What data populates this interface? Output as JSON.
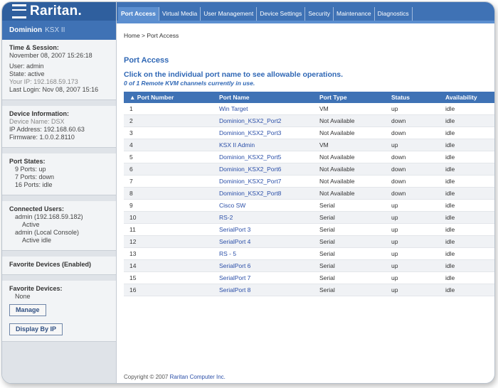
{
  "app": {
    "logo": "Raritan.",
    "product": "Dominion",
    "model": "KSX II"
  },
  "sidebar": {
    "time_session": {
      "header": "Time & Session:",
      "datetime": "November 08, 2007 15:26:18",
      "user_label": "User: admin",
      "state": "State: active",
      "ip_line": "Your IP: 192.168.59.173",
      "last_login": "Last Login: Nov 08, 2007 15:16"
    },
    "device_info": {
      "header": "Device Information:",
      "name": "Device Name: DSX",
      "ip": "IP Address: 192.168.60.63",
      "firmware": "Firmware: 1.0.0.2.8110"
    },
    "port_states": {
      "header": "Port States:",
      "up": "9 Ports: up",
      "down": "7 Ports: down",
      "idle": "16 Ports: idle"
    },
    "connected_users": {
      "header": "Connected Users:",
      "user1": "admin (192.168.59.182)",
      "user1_status": "Active",
      "user2": "admin (Local Console)",
      "user2_status": "Active idle"
    },
    "favorites_heading": "Favorite Devices (Enabled)",
    "favorite_devices": {
      "header": "Favorite Devices:",
      "value": "None",
      "manage_button": "Manage"
    },
    "display_button": "Display By IP"
  },
  "tabs": [
    "Port Access",
    "Virtual Media",
    "User Management",
    "Device Settings",
    "Security",
    "Maintenance",
    "Diagnostics"
  ],
  "active_tab": "Port Access",
  "breadcrumb": "Home > Port Access",
  "page": {
    "title": "Port Access",
    "instruction": "Click on the individual port name to see allowable operations.",
    "remote_count": "0 of 1 Remote KVM channels currently in use."
  },
  "table": {
    "headers": [
      "▲ Port Number",
      "Port Name",
      "Port Type",
      "Status",
      "Availability"
    ],
    "rows": [
      [
        "1",
        "Win Target",
        "VM",
        "up",
        "idle"
      ],
      [
        "2",
        "Dominion_KSX2_Port2",
        "Not Available",
        "down",
        "idle"
      ],
      [
        "3",
        "Dominion_KSX2_Port3",
        "Not Available",
        "down",
        "idle"
      ],
      [
        "4",
        "KSX II Admin",
        "VM",
        "up",
        "idle"
      ],
      [
        "5",
        "Dominion_KSX2_Port5",
        "Not Available",
        "down",
        "idle"
      ],
      [
        "6",
        "Dominion_KSX2_Port6",
        "Not Available",
        "down",
        "idle"
      ],
      [
        "7",
        "Dominion_KSX2_Port7",
        "Not Available",
        "down",
        "idle"
      ],
      [
        "8",
        "Dominion_KSX2_Port8",
        "Not Available",
        "down",
        "idle"
      ],
      [
        "9",
        "Cisco SW",
        "Serial",
        "up",
        "idle"
      ],
      [
        "10",
        "RS-2",
        "Serial",
        "up",
        "idle"
      ],
      [
        "11",
        "SerialPort 3",
        "Serial",
        "up",
        "idle"
      ],
      [
        "12",
        "SerialPort 4",
        "Serial",
        "up",
        "idle"
      ],
      [
        "13",
        "RS - 5",
        "Serial",
        "up",
        "idle"
      ],
      [
        "14",
        "SerialPort 6",
        "Serial",
        "up",
        "idle"
      ],
      [
        "15",
        "SerialPort 7",
        "Serial",
        "up",
        "idle"
      ],
      [
        "16",
        "SerialPort 8",
        "Serial",
        "up",
        "idle"
      ]
    ]
  },
  "footer": {
    "text": "Copyright © 2007",
    "link": "Raritan Computer Inc."
  },
  "colors": {
    "brand_blue": "#3f72b5",
    "dark_blue": "#2f5f9e",
    "link_blue": "#2b4fa8"
  }
}
